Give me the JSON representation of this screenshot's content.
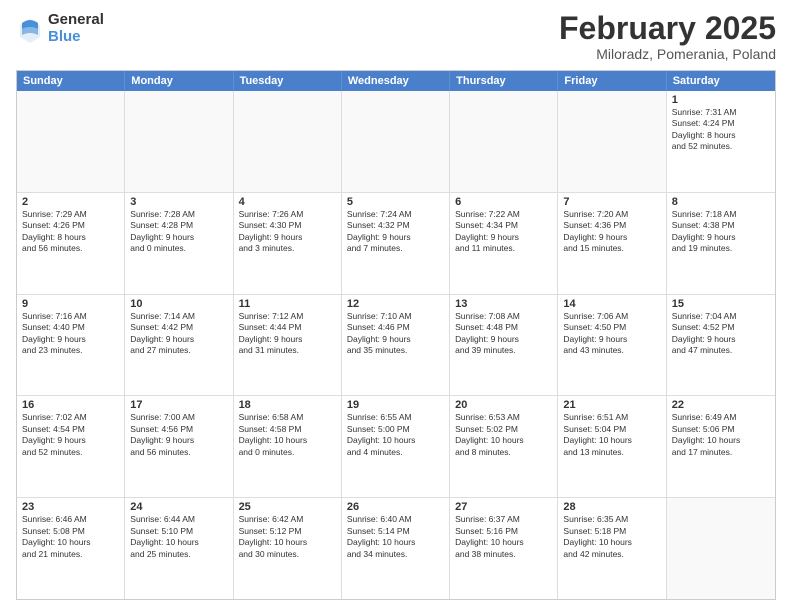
{
  "header": {
    "logo_general": "General",
    "logo_blue": "Blue",
    "month_title": "February 2025",
    "location": "Miloradz, Pomerania, Poland"
  },
  "weekdays": [
    "Sunday",
    "Monday",
    "Tuesday",
    "Wednesday",
    "Thursday",
    "Friday",
    "Saturday"
  ],
  "rows": [
    [
      {
        "day": "",
        "info": ""
      },
      {
        "day": "",
        "info": ""
      },
      {
        "day": "",
        "info": ""
      },
      {
        "day": "",
        "info": ""
      },
      {
        "day": "",
        "info": ""
      },
      {
        "day": "",
        "info": ""
      },
      {
        "day": "1",
        "info": "Sunrise: 7:31 AM\nSunset: 4:24 PM\nDaylight: 8 hours\nand 52 minutes."
      }
    ],
    [
      {
        "day": "2",
        "info": "Sunrise: 7:29 AM\nSunset: 4:26 PM\nDaylight: 8 hours\nand 56 minutes."
      },
      {
        "day": "3",
        "info": "Sunrise: 7:28 AM\nSunset: 4:28 PM\nDaylight: 9 hours\nand 0 minutes."
      },
      {
        "day": "4",
        "info": "Sunrise: 7:26 AM\nSunset: 4:30 PM\nDaylight: 9 hours\nand 3 minutes."
      },
      {
        "day": "5",
        "info": "Sunrise: 7:24 AM\nSunset: 4:32 PM\nDaylight: 9 hours\nand 7 minutes."
      },
      {
        "day": "6",
        "info": "Sunrise: 7:22 AM\nSunset: 4:34 PM\nDaylight: 9 hours\nand 11 minutes."
      },
      {
        "day": "7",
        "info": "Sunrise: 7:20 AM\nSunset: 4:36 PM\nDaylight: 9 hours\nand 15 minutes."
      },
      {
        "day": "8",
        "info": "Sunrise: 7:18 AM\nSunset: 4:38 PM\nDaylight: 9 hours\nand 19 minutes."
      }
    ],
    [
      {
        "day": "9",
        "info": "Sunrise: 7:16 AM\nSunset: 4:40 PM\nDaylight: 9 hours\nand 23 minutes."
      },
      {
        "day": "10",
        "info": "Sunrise: 7:14 AM\nSunset: 4:42 PM\nDaylight: 9 hours\nand 27 minutes."
      },
      {
        "day": "11",
        "info": "Sunrise: 7:12 AM\nSunset: 4:44 PM\nDaylight: 9 hours\nand 31 minutes."
      },
      {
        "day": "12",
        "info": "Sunrise: 7:10 AM\nSunset: 4:46 PM\nDaylight: 9 hours\nand 35 minutes."
      },
      {
        "day": "13",
        "info": "Sunrise: 7:08 AM\nSunset: 4:48 PM\nDaylight: 9 hours\nand 39 minutes."
      },
      {
        "day": "14",
        "info": "Sunrise: 7:06 AM\nSunset: 4:50 PM\nDaylight: 9 hours\nand 43 minutes."
      },
      {
        "day": "15",
        "info": "Sunrise: 7:04 AM\nSunset: 4:52 PM\nDaylight: 9 hours\nand 47 minutes."
      }
    ],
    [
      {
        "day": "16",
        "info": "Sunrise: 7:02 AM\nSunset: 4:54 PM\nDaylight: 9 hours\nand 52 minutes."
      },
      {
        "day": "17",
        "info": "Sunrise: 7:00 AM\nSunset: 4:56 PM\nDaylight: 9 hours\nand 56 minutes."
      },
      {
        "day": "18",
        "info": "Sunrise: 6:58 AM\nSunset: 4:58 PM\nDaylight: 10 hours\nand 0 minutes."
      },
      {
        "day": "19",
        "info": "Sunrise: 6:55 AM\nSunset: 5:00 PM\nDaylight: 10 hours\nand 4 minutes."
      },
      {
        "day": "20",
        "info": "Sunrise: 6:53 AM\nSunset: 5:02 PM\nDaylight: 10 hours\nand 8 minutes."
      },
      {
        "day": "21",
        "info": "Sunrise: 6:51 AM\nSunset: 5:04 PM\nDaylight: 10 hours\nand 13 minutes."
      },
      {
        "day": "22",
        "info": "Sunrise: 6:49 AM\nSunset: 5:06 PM\nDaylight: 10 hours\nand 17 minutes."
      }
    ],
    [
      {
        "day": "23",
        "info": "Sunrise: 6:46 AM\nSunset: 5:08 PM\nDaylight: 10 hours\nand 21 minutes."
      },
      {
        "day": "24",
        "info": "Sunrise: 6:44 AM\nSunset: 5:10 PM\nDaylight: 10 hours\nand 25 minutes."
      },
      {
        "day": "25",
        "info": "Sunrise: 6:42 AM\nSunset: 5:12 PM\nDaylight: 10 hours\nand 30 minutes."
      },
      {
        "day": "26",
        "info": "Sunrise: 6:40 AM\nSunset: 5:14 PM\nDaylight: 10 hours\nand 34 minutes."
      },
      {
        "day": "27",
        "info": "Sunrise: 6:37 AM\nSunset: 5:16 PM\nDaylight: 10 hours\nand 38 minutes."
      },
      {
        "day": "28",
        "info": "Sunrise: 6:35 AM\nSunset: 5:18 PM\nDaylight: 10 hours\nand 42 minutes."
      },
      {
        "day": "",
        "info": ""
      }
    ]
  ]
}
